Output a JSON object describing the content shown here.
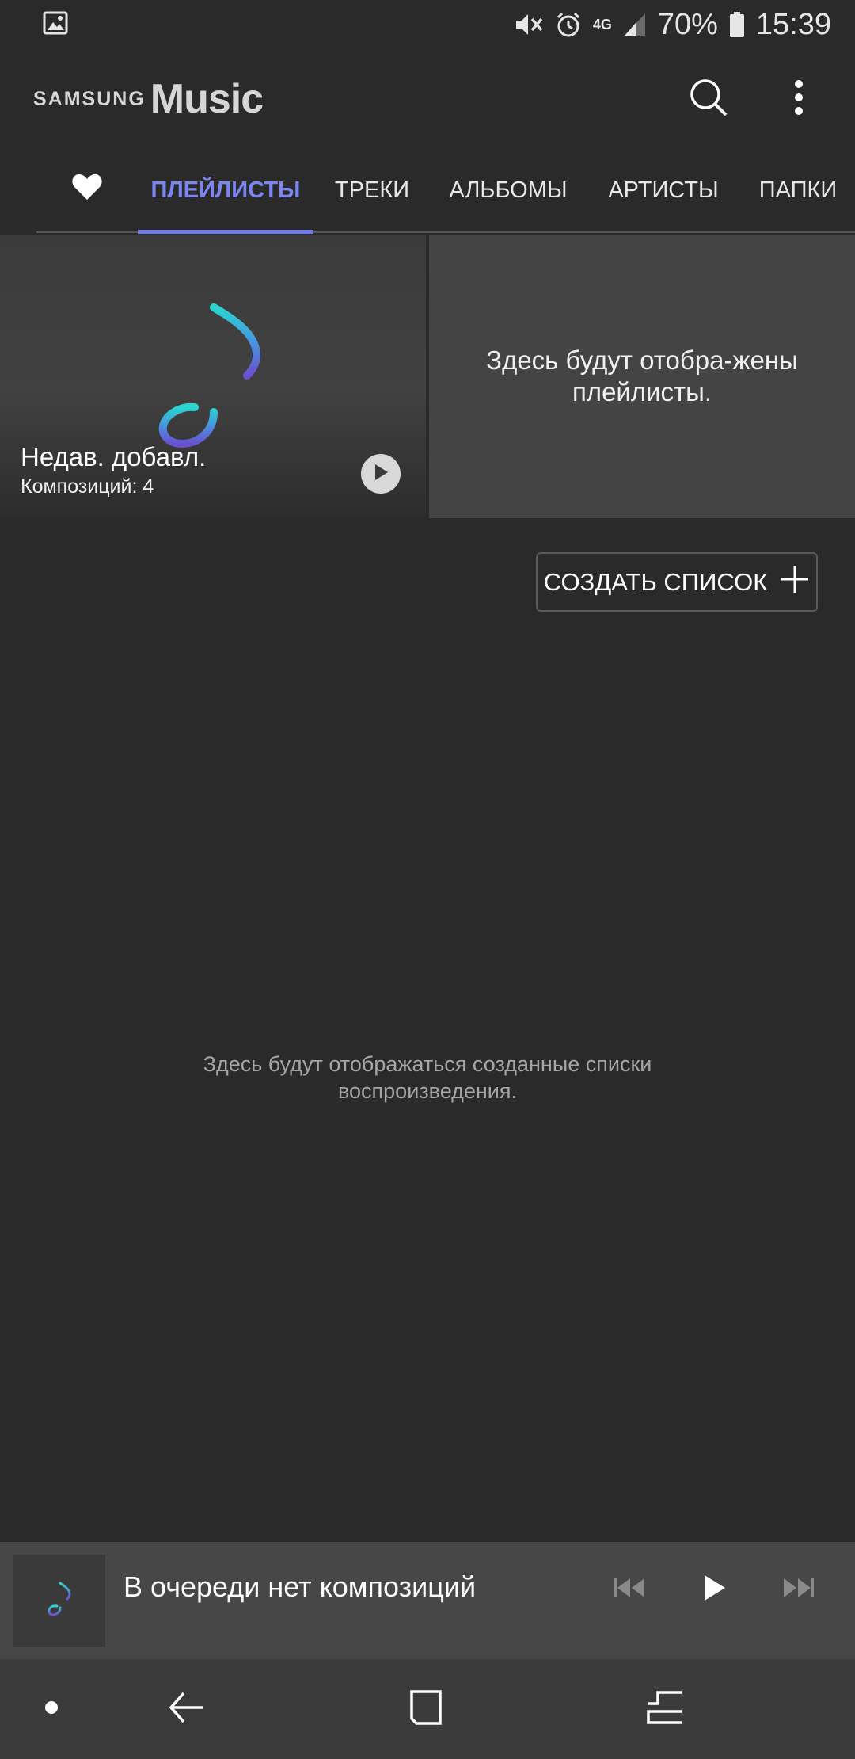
{
  "status_bar": {
    "battery": "70%",
    "time": "15:39",
    "network": "4G"
  },
  "app_bar": {
    "brand_small": "SAMSUNG",
    "brand_big": "Music"
  },
  "tabs": [
    {
      "label": "ПЛЕЙЛИСТЫ",
      "active": true
    },
    {
      "label": "ТРЕКИ",
      "active": false
    },
    {
      "label": "АЛЬБОМЫ",
      "active": false
    },
    {
      "label": "АРТИСТЫ",
      "active": false
    },
    {
      "label": "ПАПКИ",
      "active": false
    }
  ],
  "recent_card": {
    "title": "Недав. добавл.",
    "subtitle": "Композиций: 4"
  },
  "empty_card": {
    "text": "Здесь будут отобра-жены плейлисты."
  },
  "create_button": {
    "label": "СОЗДАТЬ СПИСОК"
  },
  "empty_message": "Здесь будут отображаться созданные списки воспроизведения.",
  "mini_player": {
    "title": "В очереди нет композиций"
  },
  "colors": {
    "accent": "#6f79e8",
    "background": "#2a2a2a",
    "card": "#444444",
    "player": "#474747"
  }
}
